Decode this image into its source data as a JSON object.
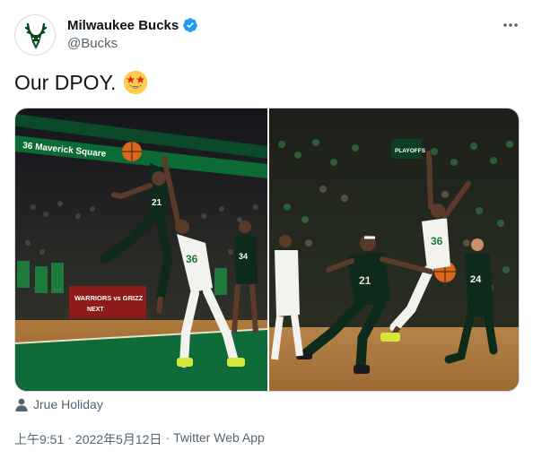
{
  "author": {
    "name": "Milwaukee Bucks",
    "handle": "@Bucks",
    "verified": true,
    "avatar_icon": "bucks-deer-logo"
  },
  "tweet": {
    "text": "Our DPOY.",
    "emoji": "star-struck-emoji"
  },
  "media": {
    "photo_count": 2,
    "left_photo": {
      "banner_text": "36 Maverick Square",
      "board_text": "WARRIORS vs GRIZZ",
      "board_subtext": "NEXT",
      "player_numbers": [
        "21",
        "36",
        "34"
      ]
    },
    "right_photo": {
      "screen_text": "PLAYOFFS",
      "player_numbers": [
        "21",
        "36",
        "24"
      ]
    }
  },
  "tagged": {
    "icon": "person-icon",
    "label": "Jrue Holiday"
  },
  "meta": {
    "time": "上午9:51",
    "separator": "·",
    "date": "2022年5月12日",
    "source": "Twitter Web App"
  },
  "colors": {
    "verified_blue": "#1d9bf0",
    "bucks_green": "#00471b",
    "celtics_green": "#007a33",
    "secondary_text": "#536471"
  }
}
